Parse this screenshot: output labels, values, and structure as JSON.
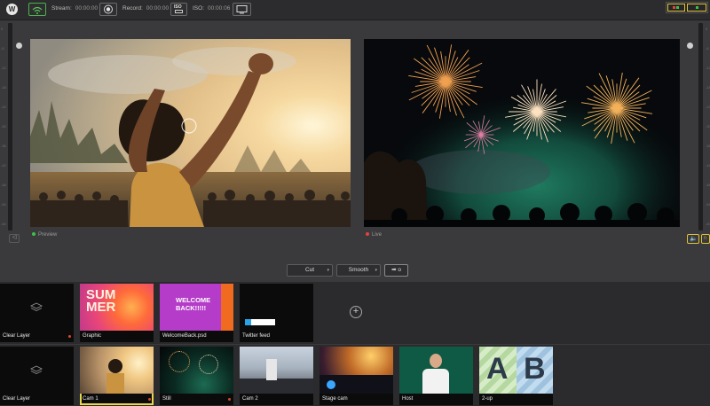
{
  "app": {
    "logo_letter": "W"
  },
  "toolbar": {
    "stream_label": "Stream:",
    "stream_time": "00:00:00",
    "record_label": "Record:",
    "record_time": "00:00:00",
    "iso_badge": "ISO",
    "iso_label": "ISO:",
    "iso_time": "00:00:06"
  },
  "audio_meter": {
    "left_segment_color": "#e0c23a",
    "right_segment_color": "#e0c23a"
  },
  "preview": {
    "label": "Preview",
    "status_color": "#3cc24a"
  },
  "live": {
    "label": "Live",
    "status_color": "#e0453a"
  },
  "transition": {
    "type": "Cut",
    "easing": "Smooth",
    "go_glyph": "➡ o"
  },
  "layers": [
    {
      "label": "Clear Layer",
      "has_dot": true
    },
    {
      "label": "Graphic",
      "has_dot": false,
      "art": "SUM\nMER"
    },
    {
      "label": "WelcomeBack.psd",
      "has_dot": false,
      "art": "WELCOME\nBACK!!!!!"
    },
    {
      "label": "Twitter feed",
      "has_dot": false
    }
  ],
  "sources": [
    {
      "label": "Clear Layer",
      "has_dot": false
    },
    {
      "label": "Cam 1",
      "has_dot": true,
      "selected": true
    },
    {
      "label": "Still",
      "has_dot": true
    },
    {
      "label": "Cam 2",
      "has_dot": false
    },
    {
      "label": "Stage cam",
      "has_dot": false
    },
    {
      "label": "Host",
      "has_dot": false
    },
    {
      "label": "2-up",
      "has_dot": false,
      "art_a": "A",
      "art_b": "B"
    }
  ],
  "fader_ticks": [
    "0",
    "-6",
    "-12",
    "-18",
    "-24",
    "-30",
    "-36",
    "-42",
    "-48",
    "-54",
    "-60"
  ],
  "colors": {
    "accent_select": "#e6d84a",
    "background": "#3a3a3c"
  }
}
